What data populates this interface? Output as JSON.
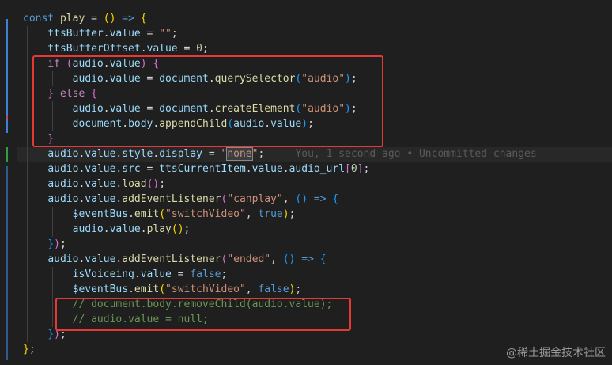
{
  "editor": {
    "lines": [
      [
        [
          "kw",
          "const"
        ],
        [
          "plain",
          " "
        ],
        [
          "fn",
          "play"
        ],
        [
          "plain",
          " = "
        ],
        [
          "brk1",
          "("
        ],
        [
          "brk1",
          ")"
        ],
        [
          "plain",
          " "
        ],
        [
          "kw",
          "=>"
        ],
        [
          "plain",
          " "
        ],
        [
          "brk1",
          "{"
        ]
      ],
      [
        [
          "plain",
          "    "
        ],
        [
          "var",
          "ttsBuffer"
        ],
        [
          "plain",
          "."
        ],
        [
          "var",
          "value"
        ],
        [
          "plain",
          " = "
        ],
        [
          "str",
          "\"\""
        ],
        [
          "plain",
          ";"
        ]
      ],
      [
        [
          "plain",
          "    "
        ],
        [
          "var",
          "ttsBufferOffset"
        ],
        [
          "plain",
          "."
        ],
        [
          "var",
          "value"
        ],
        [
          "plain",
          " = "
        ],
        [
          "num",
          "0"
        ],
        [
          "plain",
          ";"
        ]
      ],
      [
        [
          "plain",
          "    "
        ],
        [
          "kw2",
          "if"
        ],
        [
          "plain",
          " "
        ],
        [
          "brk2",
          "("
        ],
        [
          "var",
          "audio"
        ],
        [
          "plain",
          "."
        ],
        [
          "var",
          "value"
        ],
        [
          "brk2",
          ")"
        ],
        [
          "plain",
          " "
        ],
        [
          "brk2",
          "{"
        ]
      ],
      [
        [
          "plain",
          "        "
        ],
        [
          "var",
          "audio"
        ],
        [
          "plain",
          "."
        ],
        [
          "var",
          "value"
        ],
        [
          "plain",
          " = "
        ],
        [
          "var",
          "document"
        ],
        [
          "plain",
          "."
        ],
        [
          "fn",
          "querySelector"
        ],
        [
          "brk3",
          "("
        ],
        [
          "str",
          "\"audio\""
        ],
        [
          "brk3",
          ")"
        ],
        [
          "plain",
          ";"
        ]
      ],
      [
        [
          "plain",
          "    "
        ],
        [
          "brk2",
          "}"
        ],
        [
          "plain",
          " "
        ],
        [
          "kw2",
          "else"
        ],
        [
          "plain",
          " "
        ],
        [
          "brk2",
          "{"
        ]
      ],
      [
        [
          "plain",
          "        "
        ],
        [
          "var",
          "audio"
        ],
        [
          "plain",
          "."
        ],
        [
          "var",
          "value"
        ],
        [
          "plain",
          " = "
        ],
        [
          "var",
          "document"
        ],
        [
          "plain",
          "."
        ],
        [
          "fn",
          "createElement"
        ],
        [
          "brk3",
          "("
        ],
        [
          "str",
          "\"audio\""
        ],
        [
          "brk3",
          ")"
        ],
        [
          "plain",
          ";"
        ]
      ],
      [
        [
          "plain",
          "        "
        ],
        [
          "var",
          "document"
        ],
        [
          "plain",
          "."
        ],
        [
          "var",
          "body"
        ],
        [
          "plain",
          "."
        ],
        [
          "fn",
          "appendChild"
        ],
        [
          "brk3",
          "("
        ],
        [
          "var",
          "audio"
        ],
        [
          "plain",
          "."
        ],
        [
          "var",
          "value"
        ],
        [
          "brk3",
          ")"
        ],
        [
          "plain",
          ";"
        ]
      ],
      [
        [
          "plain",
          "    "
        ],
        [
          "brk2",
          "}"
        ]
      ],
      [
        [
          "plain",
          "    "
        ],
        [
          "var",
          "audio"
        ],
        [
          "plain",
          "."
        ],
        [
          "var",
          "value"
        ],
        [
          "plain",
          "."
        ],
        [
          "var",
          "style"
        ],
        [
          "plain",
          "."
        ],
        [
          "var",
          "display"
        ],
        [
          "plain",
          " = "
        ],
        [
          "str",
          "\""
        ],
        [
          "strhl",
          "none"
        ],
        [
          "str",
          "\""
        ],
        [
          "plain",
          ";"
        ],
        [
          "plain",
          "     "
        ],
        [
          "blame",
          "You, 1 second ago • Uncommitted changes"
        ]
      ],
      [
        [
          "plain",
          "    "
        ],
        [
          "var",
          "audio"
        ],
        [
          "plain",
          "."
        ],
        [
          "var",
          "value"
        ],
        [
          "plain",
          "."
        ],
        [
          "var",
          "src"
        ],
        [
          "plain",
          " = "
        ],
        [
          "var",
          "ttsCurrentItem"
        ],
        [
          "plain",
          "."
        ],
        [
          "var",
          "value"
        ],
        [
          "plain",
          "."
        ],
        [
          "var",
          "audio_url"
        ],
        [
          "brk2",
          "["
        ],
        [
          "num",
          "0"
        ],
        [
          "brk2",
          "]"
        ],
        [
          "plain",
          ";"
        ]
      ],
      [
        [
          "plain",
          "    "
        ],
        [
          "var",
          "audio"
        ],
        [
          "plain",
          "."
        ],
        [
          "var",
          "value"
        ],
        [
          "plain",
          "."
        ],
        [
          "fn",
          "load"
        ],
        [
          "brk2",
          "("
        ],
        [
          "brk2",
          ")"
        ],
        [
          "plain",
          ";"
        ]
      ],
      [
        [
          "plain",
          "    "
        ],
        [
          "var",
          "audio"
        ],
        [
          "plain",
          "."
        ],
        [
          "var",
          "value"
        ],
        [
          "plain",
          "."
        ],
        [
          "fn",
          "addEventListener"
        ],
        [
          "brk2",
          "("
        ],
        [
          "str",
          "\"canplay\""
        ],
        [
          "plain",
          ", "
        ],
        [
          "brk3",
          "("
        ],
        [
          "brk3",
          ")"
        ],
        [
          "plain",
          " "
        ],
        [
          "kw",
          "=>"
        ],
        [
          "plain",
          " "
        ],
        [
          "brk3",
          "{"
        ]
      ],
      [
        [
          "plain",
          "        "
        ],
        [
          "var",
          "$eventBus"
        ],
        [
          "plain",
          "."
        ],
        [
          "fn",
          "emit"
        ],
        [
          "brk1",
          "("
        ],
        [
          "str",
          "\"switchVideo\""
        ],
        [
          "plain",
          ", "
        ],
        [
          "bool",
          "true"
        ],
        [
          "brk1",
          ")"
        ],
        [
          "plain",
          ";"
        ]
      ],
      [
        [
          "plain",
          "        "
        ],
        [
          "var",
          "audio"
        ],
        [
          "plain",
          "."
        ],
        [
          "var",
          "value"
        ],
        [
          "plain",
          "."
        ],
        [
          "fn",
          "play"
        ],
        [
          "brk1",
          "("
        ],
        [
          "brk1",
          ")"
        ],
        [
          "plain",
          ";"
        ]
      ],
      [
        [
          "plain",
          "    "
        ],
        [
          "brk3",
          "}"
        ],
        [
          "brk2",
          ")"
        ],
        [
          "plain",
          ";"
        ]
      ],
      [
        [
          "plain",
          "    "
        ],
        [
          "var",
          "audio"
        ],
        [
          "plain",
          "."
        ],
        [
          "var",
          "value"
        ],
        [
          "plain",
          "."
        ],
        [
          "fn",
          "addEventListener"
        ],
        [
          "brk2",
          "("
        ],
        [
          "str",
          "\"ended\""
        ],
        [
          "plain",
          ", "
        ],
        [
          "brk3",
          "("
        ],
        [
          "brk3",
          ")"
        ],
        [
          "plain",
          " "
        ],
        [
          "kw",
          "=>"
        ],
        [
          "plain",
          " "
        ],
        [
          "brk3",
          "{"
        ]
      ],
      [
        [
          "plain",
          "        "
        ],
        [
          "var",
          "isVoiceing"
        ],
        [
          "plain",
          "."
        ],
        [
          "var",
          "value"
        ],
        [
          "plain",
          " = "
        ],
        [
          "bool",
          "false"
        ],
        [
          "plain",
          ";"
        ]
      ],
      [
        [
          "plain",
          "        "
        ],
        [
          "var",
          "$eventBus"
        ],
        [
          "plain",
          "."
        ],
        [
          "fn",
          "emit"
        ],
        [
          "brk1",
          "("
        ],
        [
          "str",
          "\"switchVideo\""
        ],
        [
          "plain",
          ", "
        ],
        [
          "bool",
          "false"
        ],
        [
          "brk1",
          ")"
        ],
        [
          "plain",
          ";"
        ]
      ],
      [
        [
          "plain",
          "        "
        ],
        [
          "cmt",
          "// document.body.removeChild(audio.value);"
        ]
      ],
      [
        [
          "plain",
          "        "
        ],
        [
          "cmt",
          "// audio.value = null;"
        ]
      ],
      [
        [
          "plain",
          "    "
        ],
        [
          "brk3",
          "}"
        ],
        [
          "brk2",
          ")"
        ],
        [
          "plain",
          ";"
        ]
      ],
      [
        [
          "brk1",
          "}"
        ],
        [
          "plain",
          ";"
        ]
      ]
    ]
  },
  "watermark": "@稀土掘金技术社区",
  "colors": {
    "background": "#1f1f1f",
    "highlight_box": "#e53935",
    "gutter_modified": "#3b82d6",
    "gutter_added": "#2ea043",
    "gutter_deleted": "#e53935"
  }
}
